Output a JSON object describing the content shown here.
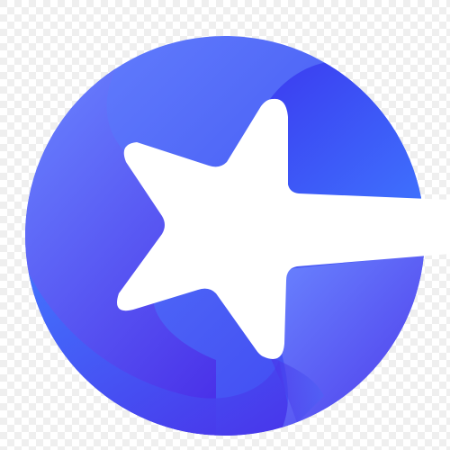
{
  "logo": {
    "icon": "blue-circle-star-logo-icon"
  },
  "background": {
    "checker_light": "#ffffff",
    "checker_dark": "#efefef"
  },
  "colors": {
    "blue_light": "#6a86ff",
    "blue_mid": "#4c63f6",
    "blue_deep": "#3b3cf0",
    "blue_violet": "#4a2fe8",
    "blue_bright": "#3f78ff",
    "star_fill": "#ffffff"
  }
}
